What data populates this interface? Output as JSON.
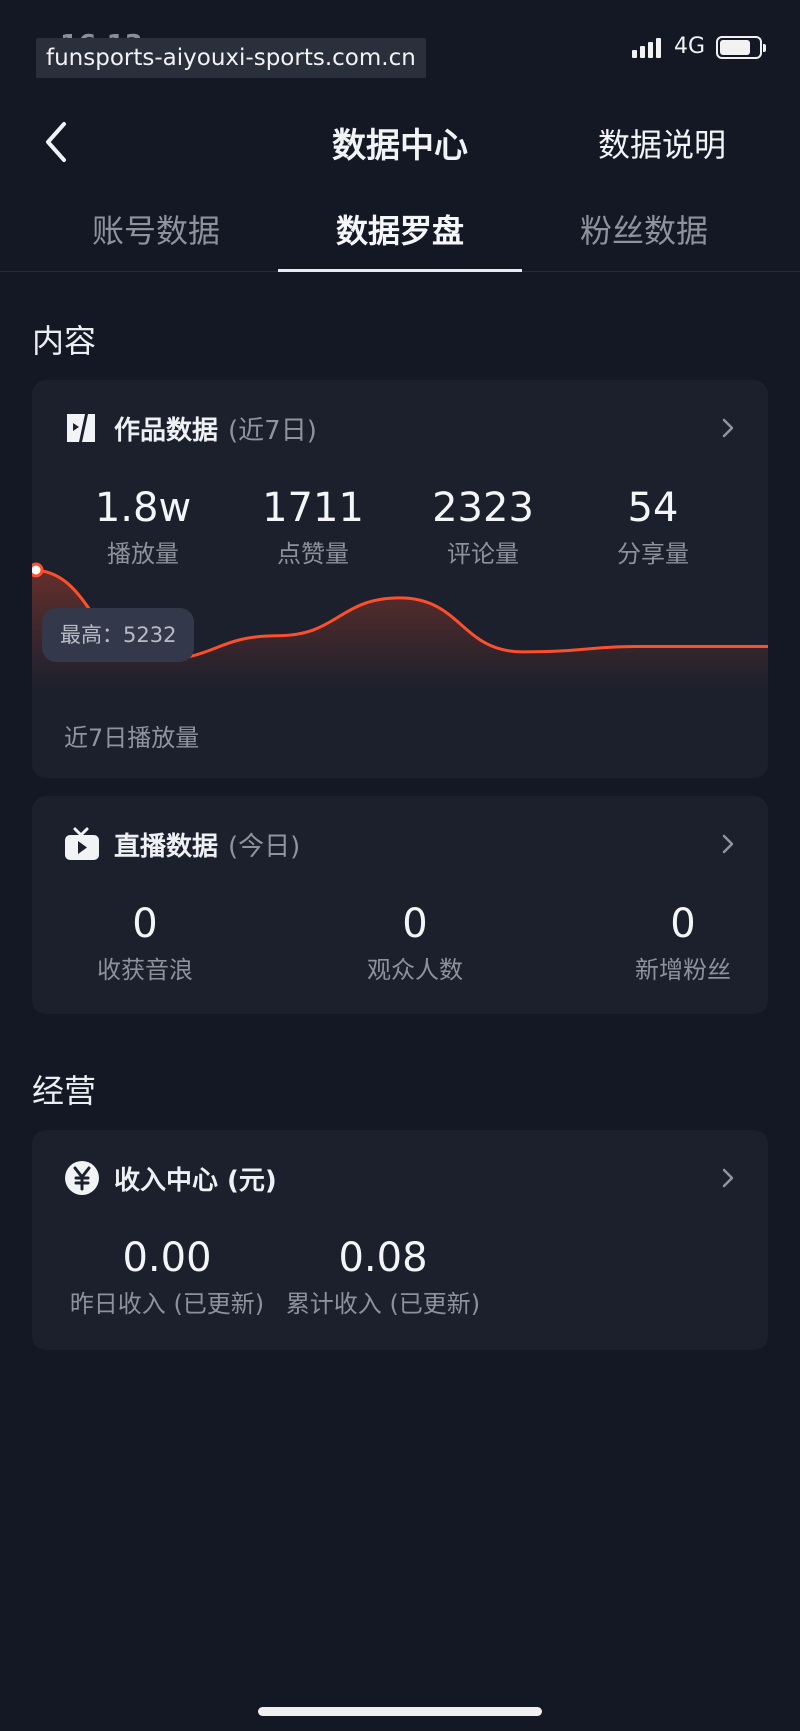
{
  "status_bar": {
    "time": "16:13",
    "watermark": "funsports-aiyouxi-sports.com.cn",
    "network": "4G",
    "battery_level": 0.7
  },
  "nav": {
    "title": "数据中心",
    "right_action": "数据说明"
  },
  "tabs": [
    {
      "label": "账号数据",
      "active": false
    },
    {
      "label": "数据罗盘",
      "active": true
    },
    {
      "label": "粉丝数据",
      "active": false
    }
  ],
  "sections": {
    "content_title": "内容",
    "business_title": "经营"
  },
  "works_card": {
    "title": "作品数据",
    "subtitle": "(近7日)",
    "metrics": [
      {
        "value": "1.8w",
        "label": "播放量"
      },
      {
        "value": "1711",
        "label": "点赞量"
      },
      {
        "value": "2323",
        "label": "评论量"
      },
      {
        "value": "54",
        "label": "分享量"
      }
    ],
    "tooltip": "最高：5232",
    "chart_caption": "近7日播放量"
  },
  "chart_data": {
    "type": "area",
    "title": "",
    "xlabel": "",
    "ylabel": "",
    "x": [
      1,
      2,
      3,
      4,
      5,
      6,
      7
    ],
    "values": [
      5232,
      1900,
      2800,
      4200,
      2200,
      2400,
      2400
    ],
    "max_label": "最高：5232",
    "line_color": "#fe4f2c",
    "grid": false,
    "legend": "none"
  },
  "live_card": {
    "title": "直播数据",
    "subtitle": "(今日)",
    "metrics": [
      {
        "value": "0",
        "label": "收获音浪"
      },
      {
        "value": "0",
        "label": "观众人数"
      },
      {
        "value": "0",
        "label": "新增粉丝"
      }
    ]
  },
  "income_card": {
    "title": "收入中心 (元)",
    "metrics": [
      {
        "value": "0.00",
        "label": "昨日收入 (已更新)"
      },
      {
        "value": "0.08",
        "label": "累计收入 (已更新)"
      }
    ]
  },
  "colors": {
    "background": "#131824",
    "card": "#1b202c",
    "accent": "#fe4f2c"
  },
  "icons": {
    "back": "chevron-left-icon",
    "works": "video-clip-icon",
    "live": "tv-icon",
    "income": "yuan-coin-icon",
    "chevron": "chevron-right-icon"
  }
}
